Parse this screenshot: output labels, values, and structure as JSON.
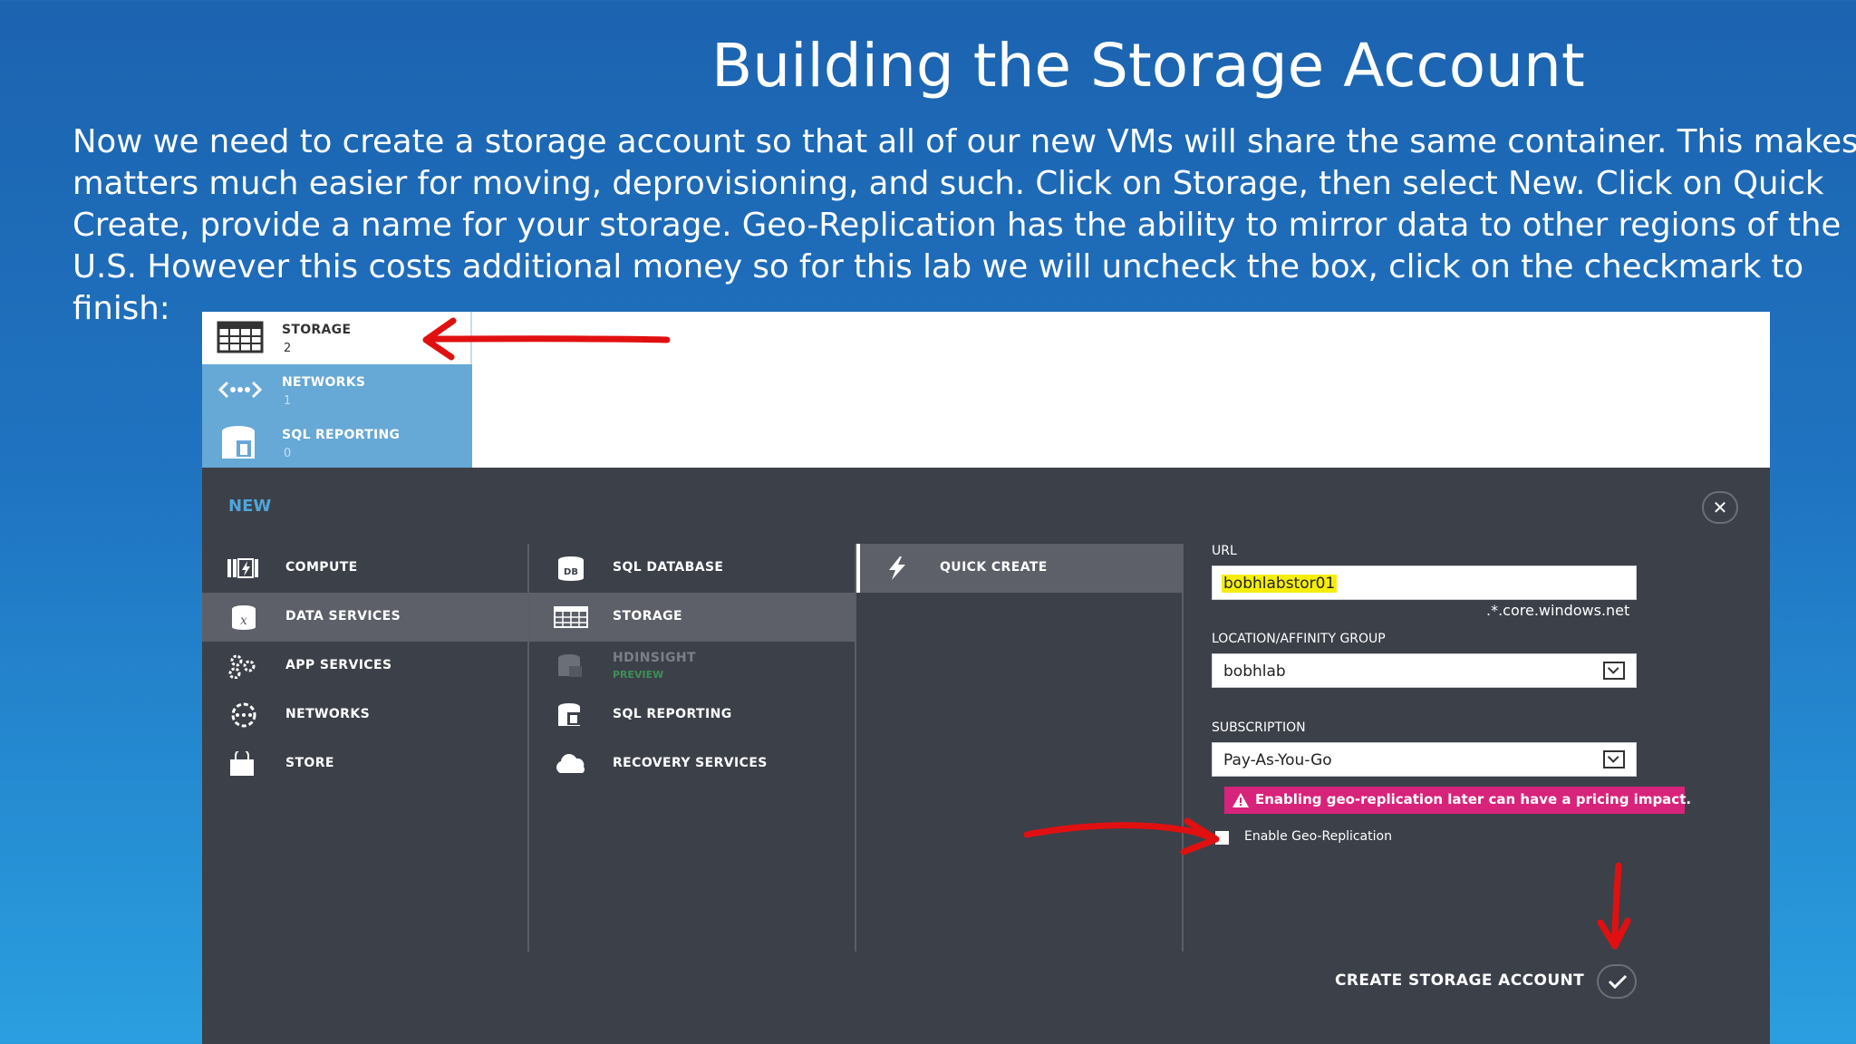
{
  "slide": {
    "title": "Building the Storage Account",
    "body_lines": [
      "Now we need to create a storage account so that all of our new VMs will share the same container.  This makes",
      "matters much easier for moving, deprovisioning, and such.  Click on Storage, then select New.  Click on Quick",
      "Create, provide a name for your storage.  Geo-Replication has the ability to mirror data to other regions of the",
      "U.S. However this costs additional money so for this lab we will uncheck the box, click on the checkmark to",
      "finish:"
    ]
  },
  "top_nav": {
    "items": [
      {
        "label": "STORAGE",
        "count": "2",
        "icon": "storage-grid-icon"
      },
      {
        "label": "NETWORKS",
        "count": "1",
        "icon": "network-icon"
      },
      {
        "label": "SQL REPORTING",
        "count": "0",
        "icon": "sql-reporting-icon"
      }
    ]
  },
  "new_panel": {
    "title": "NEW",
    "close_symbol": "✕",
    "categories": [
      {
        "label": "COMPUTE",
        "icon": "compute-icon"
      },
      {
        "label": "DATA SERVICES",
        "icon": "data-services-icon"
      },
      {
        "label": "APP SERVICES",
        "icon": "app-services-icon"
      },
      {
        "label": "NETWORKS",
        "icon": "network-icon"
      },
      {
        "label": "STORE",
        "icon": "store-bag-icon"
      }
    ],
    "services": [
      {
        "label": "SQL DATABASE",
        "icon": "sql-database-icon"
      },
      {
        "label": "STORAGE",
        "icon": "storage-grid-icon"
      },
      {
        "label": "HDINSIGHT",
        "sub": "PREVIEW",
        "icon": "hdinsight-icon"
      },
      {
        "label": "SQL REPORTING",
        "icon": "sql-reporting-icon"
      },
      {
        "label": "RECOVERY SERVICES",
        "icon": "cloud-icon"
      }
    ],
    "quick_create": {
      "label": "QUICK CREATE",
      "icon": "lightning-icon"
    },
    "form": {
      "url_label": "URL",
      "url_value": "bobhlabstor01",
      "url_suffix": ".*.core.windows.net",
      "location_label": "LOCATION/AFFINITY GROUP",
      "location_value": "bobhlab",
      "subscription_label": "SUBSCRIPTION",
      "subscription_value": "Pay-As-You-Go",
      "warning": "Enabling geo-replication later can have a pricing impact.",
      "checkbox_label": "Enable Geo-Replication",
      "create_label": "CREATE STORAGE ACCOUNT"
    }
  },
  "colors": {
    "background_top": "#1c63b0",
    "background_bottom": "#2a9fe0",
    "nav_blue": "#66a8d6",
    "panel_dark": "#3c4049",
    "selected_item": "#5d6069",
    "new_title": "#4ea6dc",
    "warning_pink": "#d8237b",
    "url_highlight": "#f5ee0a",
    "annotation_red": "#e11010"
  }
}
